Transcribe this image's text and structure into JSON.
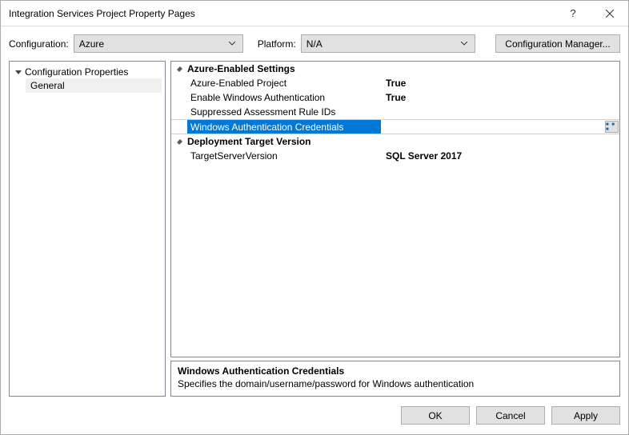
{
  "window": {
    "title": "Integration Services Project Property Pages"
  },
  "toolbar": {
    "config_label": "Configuration:",
    "config_value": "Azure",
    "platform_label": "Platform:",
    "platform_value": "N/A",
    "config_manager": "Configuration Manager..."
  },
  "tree": {
    "root": "Configuration Properties",
    "child": "General"
  },
  "propgrid": {
    "cat1": "Azure-Enabled Settings",
    "rows1": {
      "r0": {
        "name": "Azure-Enabled Project",
        "value": "True"
      },
      "r1": {
        "name": "Enable Windows Authentication",
        "value": "True"
      },
      "r2": {
        "name": "Suppressed Assessment Rule IDs",
        "value": ""
      },
      "r3": {
        "name": "Windows Authentication Credentials",
        "value": ""
      }
    },
    "cat2": "Deployment Target Version",
    "rows2": {
      "r0": {
        "name": "TargetServerVersion",
        "value": "SQL Server 2017"
      }
    }
  },
  "description": {
    "title": "Windows Authentication Credentials",
    "text": "Specifies the domain/username/password for Windows authentication"
  },
  "footer": {
    "ok": "OK",
    "cancel": "Cancel",
    "apply": "Apply"
  }
}
